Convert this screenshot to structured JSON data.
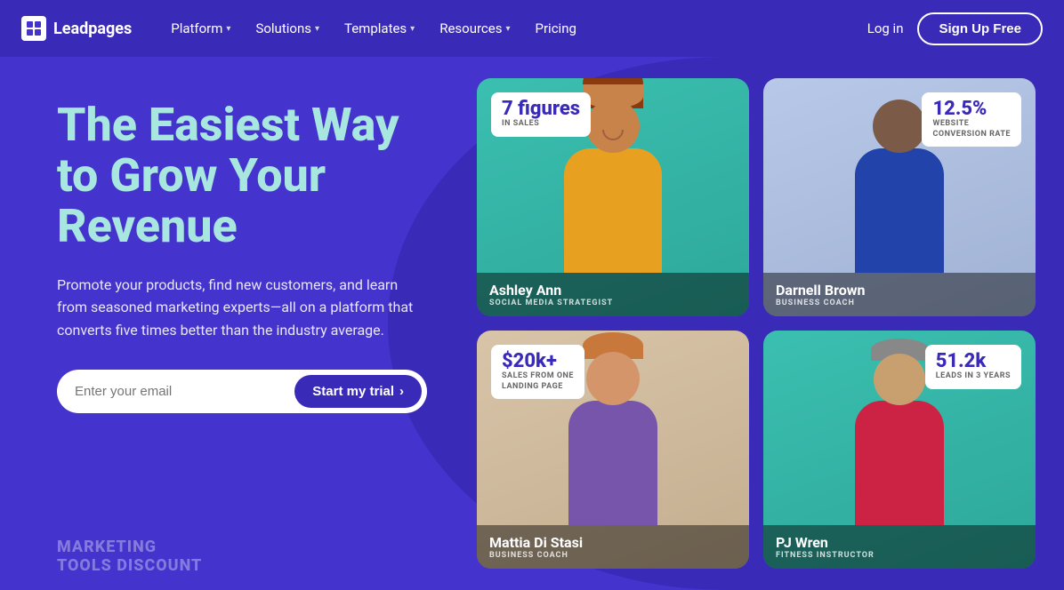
{
  "nav": {
    "logo_text": "Leadpages",
    "items": [
      {
        "label": "Platform",
        "has_dropdown": true
      },
      {
        "label": "Solutions",
        "has_dropdown": true
      },
      {
        "label": "Templates",
        "has_dropdown": true
      },
      {
        "label": "Resources",
        "has_dropdown": true
      },
      {
        "label": "Pricing",
        "has_dropdown": false
      }
    ],
    "login_label": "Log in",
    "signup_label": "Sign Up Free"
  },
  "hero": {
    "title_line1": "The Easiest Way",
    "title_line2": "to Grow Your",
    "title_line3": "Revenue",
    "subtitle": "Promote your products, find new customers, and learn from seasoned marketing experts—all on a platform that converts five times better than the industry average.",
    "email_placeholder": "Enter your email",
    "trial_btn_label": "Start my trial",
    "watermark_line1": "MARKETING",
    "watermark_line2": "TOOLS DISCOUNT"
  },
  "cards": [
    {
      "id": "ashley",
      "stat_number": "7 figures",
      "stat_label": "IN SALES",
      "name": "Ashley Ann",
      "role": "SOCIAL MEDIA STRATEGIST",
      "bg": "#3bbfb0",
      "skin": "#c8834a",
      "outfit": "#e8a020"
    },
    {
      "id": "darnell",
      "stat_number": "12.5%",
      "stat_label": "WEBSITE\nCONVERSION RATE",
      "stat_position": "top-right",
      "name": "Darnell Brown",
      "role": "BUSINESS COACH",
      "bg": "#b0bedd",
      "skin": "#7B5B48",
      "outfit": "#2244aa"
    },
    {
      "id": "mattia",
      "stat_number": "$20k+",
      "stat_label": "SALES FROM ONE\nLANDING PAGE",
      "name": "Mattia Di Stasi",
      "role": "BUSINESS COACH",
      "bg": "#d8c4a8",
      "skin": "#d4956a",
      "outfit": "#7755aa"
    },
    {
      "id": "pj",
      "stat_number": "51.2k",
      "stat_label": "LEADS IN 3 YEARS",
      "stat_position": "top-right",
      "name": "PJ Wren",
      "role": "FITNESS INSTRUCTOR",
      "bg": "#3bbfb0",
      "skin": "#c8a070",
      "outfit": "#cc2244"
    }
  ]
}
